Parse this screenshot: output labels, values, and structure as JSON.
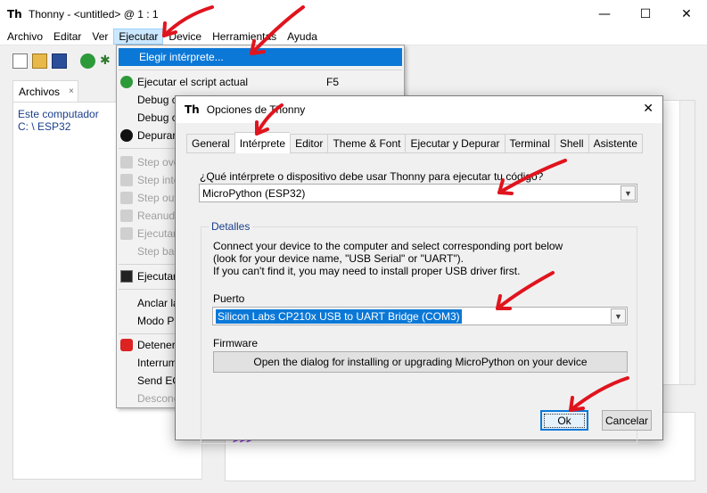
{
  "window": {
    "title": "Thonny  -  <untitled>  @  1 : 1",
    "minimize_glyph": "—",
    "maximize_glyph": "☐",
    "close_glyph": "✕"
  },
  "menubar": [
    "Archivo",
    "Editar",
    "Ver",
    "Ejecutar",
    "Device",
    "Herramientas",
    "Ayuda"
  ],
  "files_panel": {
    "tab_label": "Archivos",
    "close_glyph": "×",
    "items": [
      "Este computador",
      "C: \\ ESP32"
    ]
  },
  "shell": {
    "prompt": ">>>"
  },
  "run_menu": {
    "items": [
      {
        "label": "Elegir intérprete...",
        "state": "highlighted"
      },
      {
        "label": "Ejecutar el script actual",
        "shortcut": "F5",
        "icon": "run-icon"
      },
      {
        "label": "Debug c"
      },
      {
        "label": "Debug c"
      },
      {
        "label": "Depurar",
        "icon": "debug-icon"
      },
      {
        "label": "Step ove",
        "state": "disabled"
      },
      {
        "label": "Step inte",
        "state": "disabled"
      },
      {
        "label": "Step out",
        "state": "disabled"
      },
      {
        "label": "Reanuda",
        "state": "disabled"
      },
      {
        "label": "Ejecutar",
        "state": "disabled"
      },
      {
        "label": "Step bac",
        "state": "disabled"
      },
      {
        "label": "Ejecutar",
        "icon": "terminal-icon"
      },
      {
        "label": "Anclar la"
      },
      {
        "label": "Modo P"
      },
      {
        "label": "Detener/",
        "icon": "stop-icon"
      },
      {
        "label": "Interrum"
      },
      {
        "label": "Send EO"
      },
      {
        "label": "Descone",
        "state": "disabled"
      }
    ]
  },
  "dialog": {
    "title": "Opciones de Thonny",
    "close_glyph": "✕",
    "tabs": [
      "General",
      "Intérprete",
      "Editor",
      "Theme & Font",
      "Ejecutar y Depurar",
      "Terminal",
      "Shell",
      "Asistente"
    ],
    "active_tab": "Intérprete",
    "question": "¿Qué intérprete o dispositivo debe usar Thonny para ejecutar tu código?",
    "interpreter_value": "MicroPython (ESP32)",
    "details_legend": "Detalles",
    "details_lines": [
      "Connect your device to the computer and select corresponding port below",
      "(look for your device name, \"USB Serial\" or \"UART\").",
      "If you can't find it, you may need to install proper USB driver first."
    ],
    "port_label": "Puerto",
    "port_value": "Silicon Labs CP210x USB to UART Bridge (COM3)",
    "firmware_label": "Firmware",
    "firmware_button": "Open the dialog for installing or upgrading MicroPython on your device",
    "ok_button": "Ok",
    "cancel_button": "Cancelar"
  },
  "annotation_color": "#e0141e"
}
